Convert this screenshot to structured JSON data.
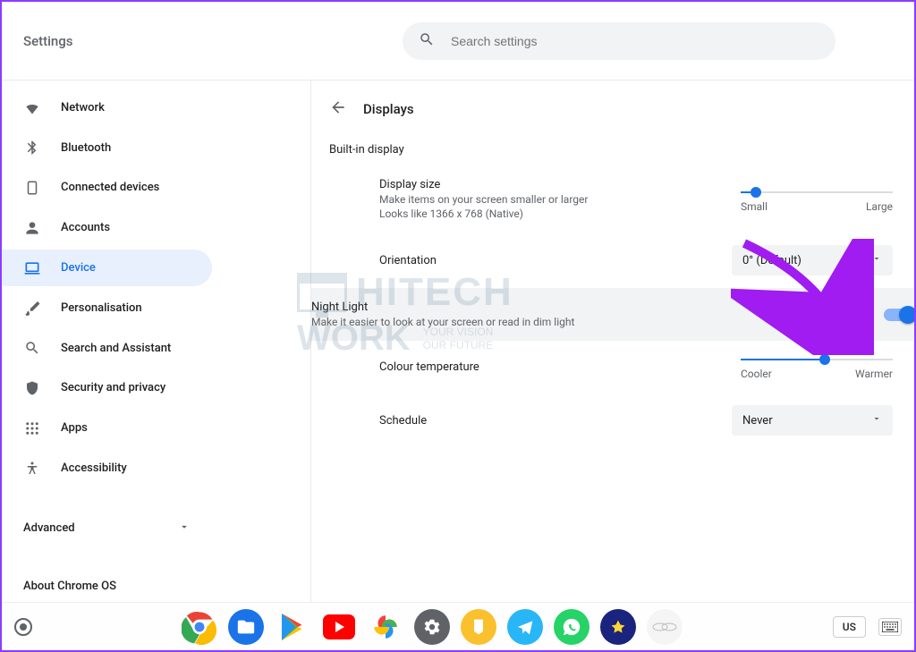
{
  "app_title": "Settings",
  "search": {
    "placeholder": "Search settings"
  },
  "sidebar": {
    "items": [
      {
        "label": "Network",
        "icon": "wifi"
      },
      {
        "label": "Bluetooth",
        "icon": "bluetooth"
      },
      {
        "label": "Connected devices",
        "icon": "devices"
      },
      {
        "label": "Accounts",
        "icon": "person"
      },
      {
        "label": "Device",
        "icon": "laptop",
        "active": true
      },
      {
        "label": "Personalisation",
        "icon": "brush"
      },
      {
        "label": "Search and Assistant",
        "icon": "search"
      },
      {
        "label": "Security and privacy",
        "icon": "shield"
      },
      {
        "label": "Apps",
        "icon": "apps"
      },
      {
        "label": "Accessibility",
        "icon": "accessibility"
      }
    ],
    "advanced_label": "Advanced",
    "about_label": "About Chrome OS"
  },
  "main": {
    "page_title": "Displays",
    "section_title": "Built-in display",
    "display_size": {
      "title": "Display size",
      "desc": "Make items on your screen smaller or larger",
      "resolution": "Looks like 1366 x 768 (Native)",
      "min_label": "Small",
      "max_label": "Large",
      "percent": 10
    },
    "orientation": {
      "title": "Orientation",
      "value": "0° (Default)"
    },
    "night_light": {
      "title": "Night Light",
      "desc": "Make it easier to look at your screen or read in dim light",
      "enabled": true
    },
    "colour_temp": {
      "title": "Colour temperature",
      "min_label": "Cooler",
      "max_label": "Warmer",
      "percent": 55
    },
    "schedule": {
      "title": "Schedule",
      "value": "Never"
    }
  },
  "shelf": {
    "locale": "US"
  },
  "watermark": {
    "brand_top": "HITECH",
    "brand_bottom": "WORK",
    "tag1": "YOUR VISION",
    "tag2": "OUR FUTURE"
  }
}
